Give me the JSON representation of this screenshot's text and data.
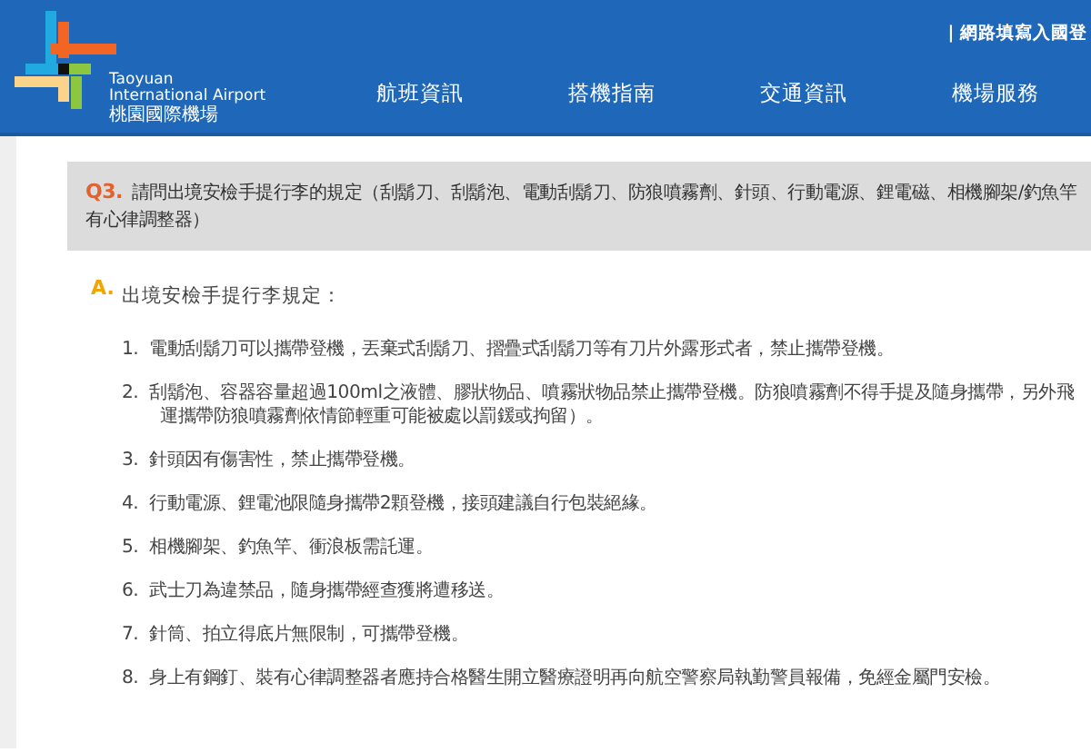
{
  "header": {
    "logo": {
      "name_lines": [
        "Taoyuan",
        "International Airport"
      ],
      "name_zh": "桃園國際機場"
    },
    "top_link": "| 網路填寫入國登",
    "nav": [
      {
        "label": "航班資訊"
      },
      {
        "label": "搭機指南"
      },
      {
        "label": "交通資訊"
      },
      {
        "label": "機場服務"
      }
    ]
  },
  "question": {
    "number": "Q3.",
    "lines": [
      "請問出境安檢手提行李的規定（刮鬍刀、刮鬍泡、電動刮鬍刀、防狼噴霧劑、針頭、行動電源、鋰電磁、相機腳架/釣魚竿",
      "有心律調整器）"
    ]
  },
  "answer": {
    "marker": "A.",
    "intro": "出境安檢手提行李規定：",
    "items": [
      {
        "number": "1.",
        "lines": [
          "電動刮鬍刀可以攜帶登機，丟棄式刮鬍刀、摺疊式刮鬍刀等有刀片外露形式者，禁止攜帶登機。"
        ]
      },
      {
        "number": "2.",
        "lines": [
          "刮鬍泡、容器容量超過100ml之液體、膠狀物品、噴霧狀物品禁止攜帶登機。防狼噴霧劑不得手提及隨身攜帶，另外飛",
          "運攜帶防狼噴霧劑依情節輕重可能被處以罰鍰或拘留）。"
        ]
      },
      {
        "number": "3.",
        "lines": [
          "針頭因有傷害性，禁止攜帶登機。"
        ]
      },
      {
        "number": "4.",
        "lines": [
          "行動電源、鋰電池限隨身攜帶2顆登機，接頭建議自行包裝絕緣。"
        ]
      },
      {
        "number": "5.",
        "lines": [
          "相機腳架、釣魚竿、衝浪板需託運。"
        ]
      },
      {
        "number": "6.",
        "lines": [
          "武士刀為違禁品，隨身攜帶經查獲將遭移送。"
        ]
      },
      {
        "number": "7.",
        "lines": [
          "針筒、拍立得底片無限制，可攜帶登機。"
        ]
      },
      {
        "number": "8.",
        "lines": [
          "身上有鋼釘、裝有心律調整器者應持合格醫生開立醫療證明再向航空警察局執勤警員報備，免經金屬門安檢。"
        ]
      }
    ]
  }
}
